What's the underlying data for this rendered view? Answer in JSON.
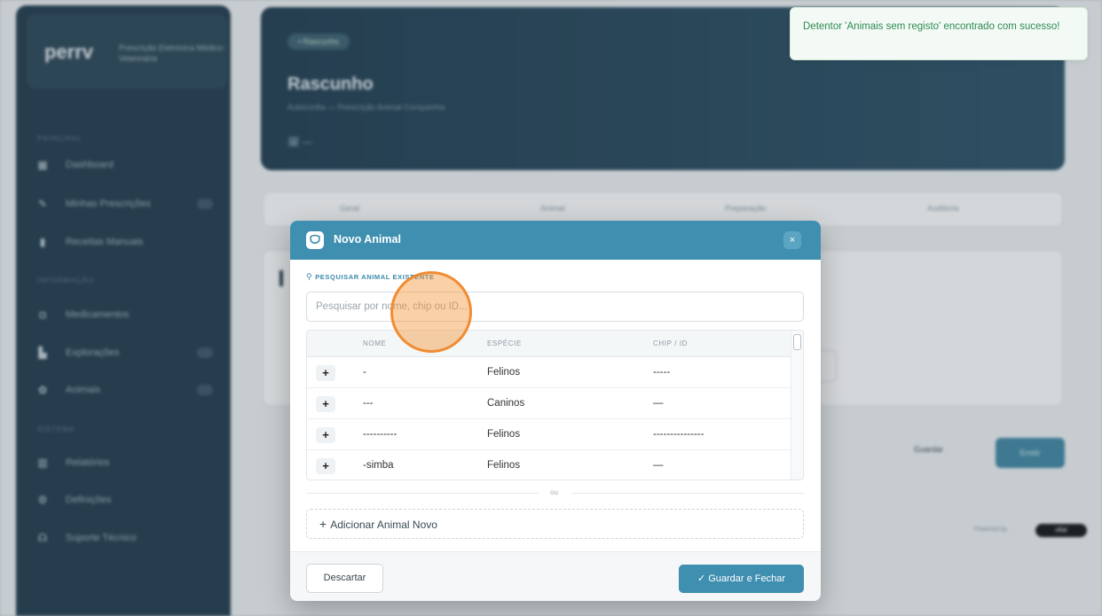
{
  "sidebar": {
    "brand_logo": "perrv",
    "brand_sub": "Prescrição Eletrónica Médico-Veterinária",
    "section_1": "PRINCIPAL",
    "section_2": "INFORMAÇÃO",
    "section_3": "SISTEMA",
    "items": [
      {
        "label": "Dashboard"
      },
      {
        "label": "Minhas Prescrições"
      },
      {
        "label": "Receitas Manuais"
      },
      {
        "label": "Medicamentos"
      },
      {
        "label": "Explorações"
      },
      {
        "label": "Animais"
      },
      {
        "label": "Relatórios"
      },
      {
        "label": "Definições"
      },
      {
        "label": "Suporte Técnico"
      }
    ]
  },
  "hero": {
    "badge": "• Rascunho",
    "title": "Rascunho",
    "subtitle": "Autoconfia — Prescrição Animal Companhia",
    "date": "🗓 —"
  },
  "tabs": [
    "Geral",
    "Animal",
    "Preparação",
    "Auditoria"
  ],
  "actions": {
    "save": "Guardar",
    "emit": "Emitir"
  },
  "powered": {
    "label": "Powered by",
    "brand": "ofiat"
  },
  "toast": {
    "message": "Detentor 'Animais sem registo' encontrado com sucesso!"
  },
  "modal": {
    "title": "Novo Animal",
    "close": "×",
    "search_label": "PESQUISAR ANIMAL EXISTENTE",
    "search_placeholder": "Pesquisar por nome, chip ou ID...",
    "columns": [
      "NOME",
      "ESPÉCIE",
      "CHIP / ID"
    ],
    "rows": [
      {
        "add": "+",
        "name": "-",
        "species": "Felinos",
        "chip": "-----"
      },
      {
        "add": "+",
        "name": "---",
        "species": "Caninos",
        "chip": "—"
      },
      {
        "add": "+",
        "name": "----------",
        "species": "Felinos",
        "chip": "---------------"
      },
      {
        "add": "+",
        "name": "-simba",
        "species": "Felinos",
        "chip": "—"
      }
    ],
    "or_text": "ou",
    "add_new": "Adicionar Animal Novo",
    "discard": "Descartar",
    "save_close": "✓ Guardar e Fechar"
  },
  "colors": {
    "accent": "#3f8fb0",
    "sidebar": "#1f3a4b",
    "toast_text": "#2f8a52",
    "click_indicator": "#f0801e"
  }
}
